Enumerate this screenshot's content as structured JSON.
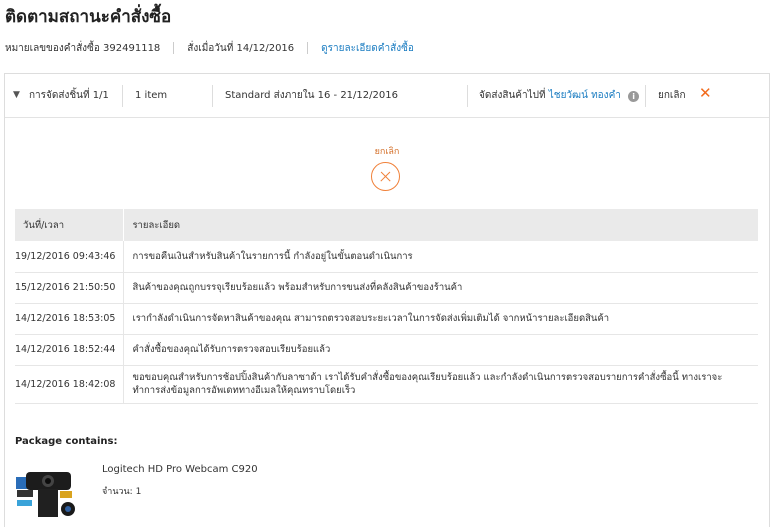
{
  "page": {
    "title": "ติดตามสถานะคำสั่งซื้อ"
  },
  "order_meta": {
    "order_number": "หมายเลขของคำสั่งซื้อ 392491118",
    "ordered_on": "สั่งเมื่อวันที่ 14/12/2016",
    "details_link": "ดูรายละเอียดคำสั่งซื้อ"
  },
  "shipment": {
    "label": "การจัดส่งชิ้นที่ 1/1",
    "item_count": "1 item",
    "delivery": "Standard ส่งภายใน 16 - 21/12/2016",
    "ship_to_prefix": "จัดส่งสินค้าไปที่",
    "ship_to_name": "ไชยวัฒน์ ทองคำ",
    "status": "ยกเลิก"
  },
  "status_block": {
    "label": "ยกเลิก"
  },
  "history": {
    "headers": [
      "วันที่/เวลา",
      "รายละเอียด"
    ],
    "rows": [
      {
        "time": "19/12/2016 09:43:46",
        "detail": "การขอคืนเงินสำหรับสินค้าในรายการนี้ กำลังอยู่ในขั้นตอนดำเนินการ"
      },
      {
        "time": "15/12/2016 21:50:50",
        "detail": "สินค้าของคุณถูกบรรจุเรียบร้อยแล้ว พร้อมสำหรับการขนส่งที่คลังสินค้าของร้านค้า"
      },
      {
        "time": "14/12/2016 18:53:05",
        "detail": "เรากำลังดำเนินการจัดหาสินค้าของคุณ สามารถตรวจสอบระยะเวลาในการจัดส่งเพิ่มเติมได้ จากหน้ารายละเอียดสินค้า"
      },
      {
        "time": "14/12/2016 18:52:44",
        "detail": "คำสั่งซื้อของคุณได้รับการตรวจสอบเรียบร้อยแล้ว"
      },
      {
        "time": "14/12/2016 18:42:08",
        "detail": "ขอขอบคุณสำหรับการช้อปปิ้งสินค้ากับลาซาด้า เราได้รับคำสั่งซื้อของคุณเรียบร้อยแล้ว และกำลังดำเนินการตรวจสอบรายการคำสั่งซื้อนี้ ทางเราจะทำการส่งข้อมูลการอัพเดททางอีเมลให้คุณทราบโดยเร็ว"
      }
    ]
  },
  "package": {
    "title": "Package contains:",
    "product_name": "Logitech HD Pro Webcam C920",
    "quantity": "จำนวน: 1"
  },
  "colors": {
    "accent": "#f26b1d",
    "link": "#1a7cc1"
  }
}
